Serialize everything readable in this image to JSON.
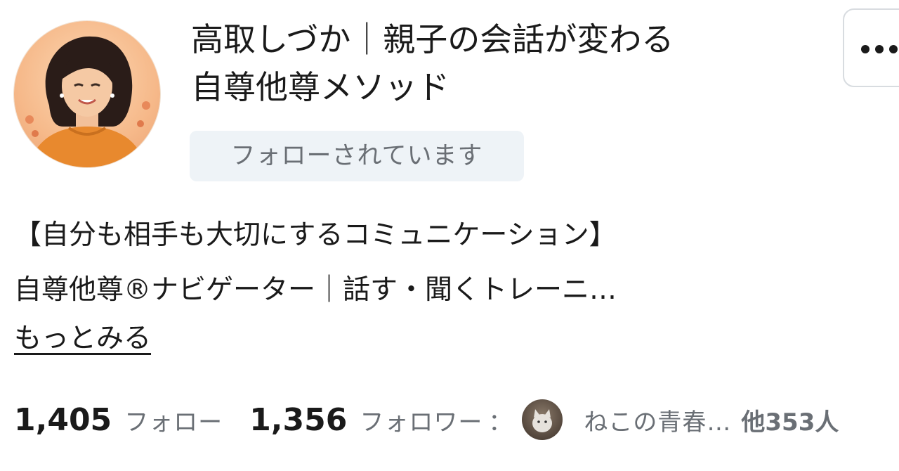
{
  "profile": {
    "name_line1": "高取しづか｜親子の会話が変わる",
    "name_line2": "自尊他尊メソッド",
    "follows_you_badge": "フォローされています"
  },
  "bio": {
    "line1": "【自分も相手も大切にするコミュニケーション】",
    "line2": "自尊他尊®ナビゲーター｜話す・聞くトレーニ…",
    "more_link": "もっとみる"
  },
  "stats": {
    "following_count": "1,405",
    "following_label": "フォロー",
    "followers_count": "1,356",
    "followers_label": "フォロワー",
    "separator": "：",
    "follower_preview_names": "ねこの青春…",
    "others": "他353人"
  },
  "icons": {
    "more": "more-horizontal-icon"
  },
  "colors": {
    "badge_bg": "#eef3f7",
    "muted_text": "#6a6f75",
    "text": "#1a1a1a"
  }
}
